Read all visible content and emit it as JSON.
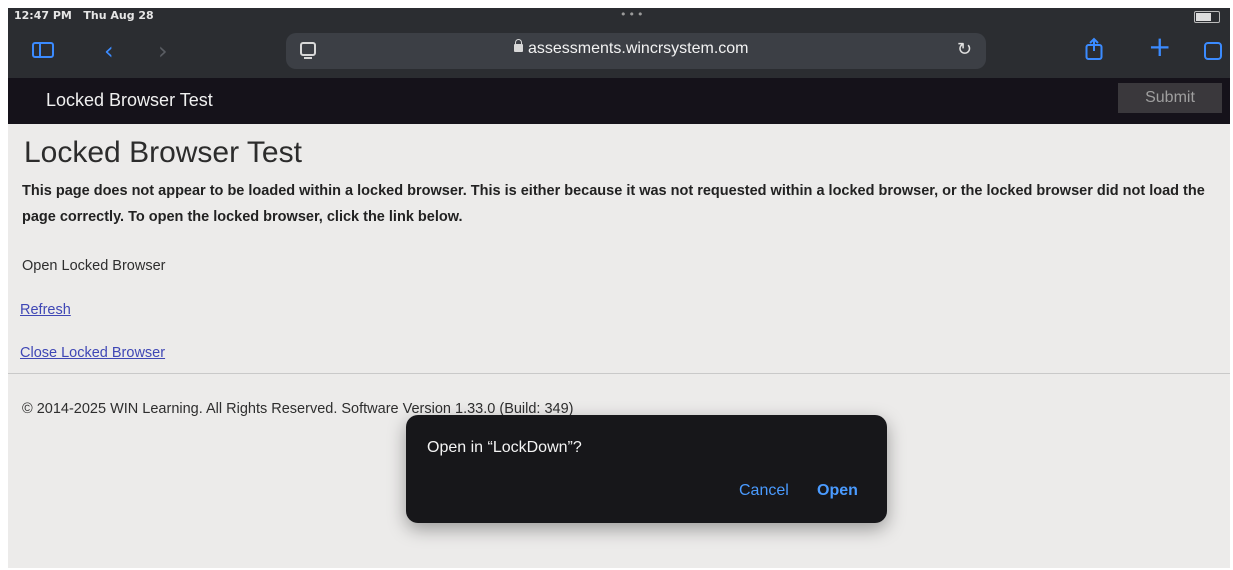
{
  "status_bar": {
    "time": "12:47 PM",
    "date": "Thu Aug 28",
    "dots": "•••",
    "battery_icon": "battery-icon"
  },
  "browser": {
    "url": "assessments.wincrsystem.com",
    "icons": {
      "sidebar": "sidebar-icon",
      "back": "‹",
      "forward": "›",
      "reload": "↻",
      "share": "share-icon",
      "new_tab": "+",
      "tabs": "tabs-icon"
    },
    "accent_color": "#3b8bff"
  },
  "site_header": {
    "title": "Locked Browser Test",
    "submit_label": "Submit"
  },
  "main": {
    "title": "Locked Browser Test",
    "notice": "This page does not appear to be loaded within a locked browser. This is either because it was not requested within a locked browser, or the locked browser did not load the page correctly. To open the locked browser, click the link below.",
    "open_locked_browser": "Open Locked Browser",
    "refresh_link": "Refresh",
    "close_link": "Close Locked Browser",
    "footer": "© 2014-2025 WIN Learning. All Rights Reserved. Software Version 1.33.0 (Build: 349)"
  },
  "dialog": {
    "title": "Open in “LockDown”?",
    "cancel_label": "Cancel",
    "open_label": "Open"
  }
}
